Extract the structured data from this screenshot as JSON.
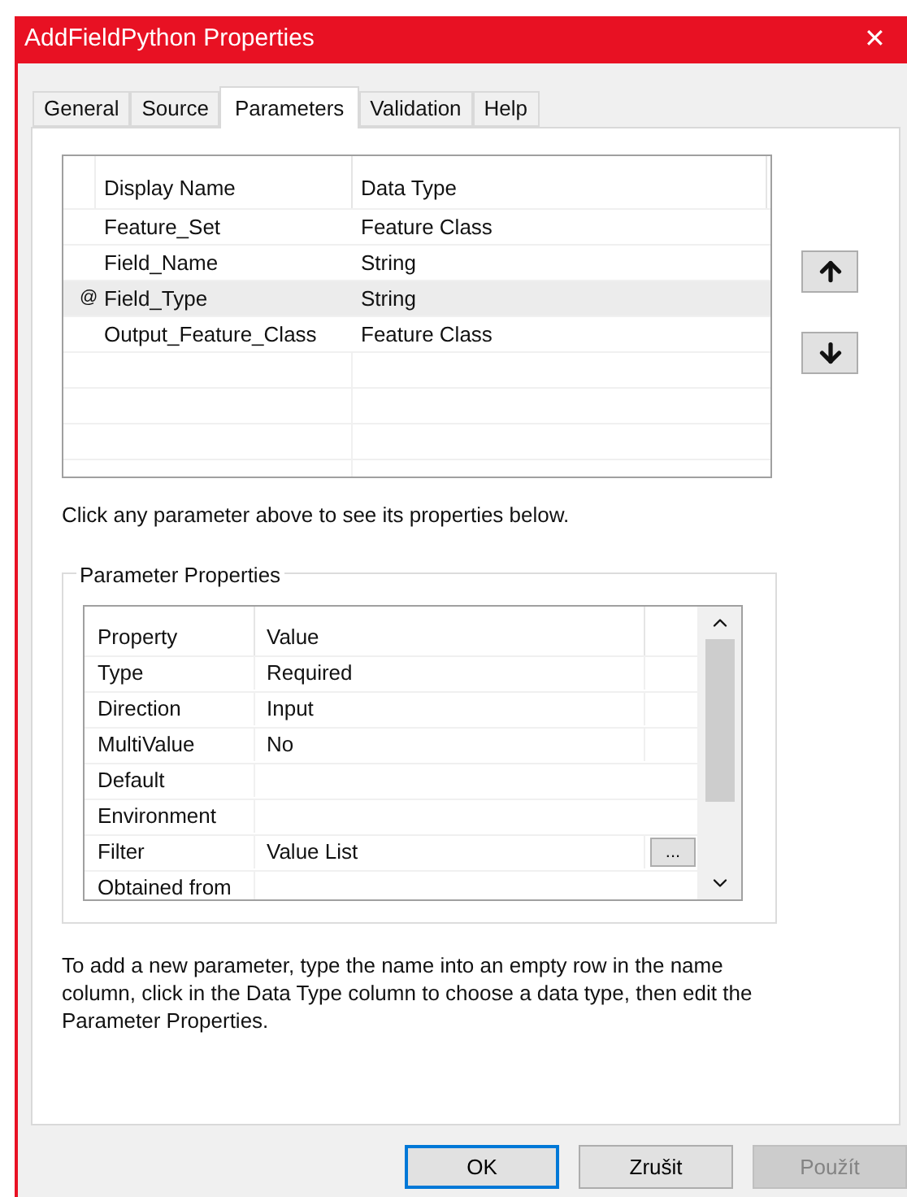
{
  "window": {
    "title": "AddFieldPython Properties",
    "close": "✕"
  },
  "tabs": [
    {
      "label": "General",
      "selected": false
    },
    {
      "label": "Source",
      "selected": false
    },
    {
      "label": "Parameters",
      "selected": true
    },
    {
      "label": "Validation",
      "selected": false
    },
    {
      "label": "Help",
      "selected": false
    }
  ],
  "parameters": {
    "columns": [
      "Display Name",
      "Data Type"
    ],
    "rows": [
      {
        "name": "Feature_Set",
        "type": "Feature Class",
        "selected": false
      },
      {
        "name": "Field_Name",
        "type": "String",
        "selected": false
      },
      {
        "name": "Field_Type",
        "type": "String",
        "selected": true,
        "marker": "@"
      },
      {
        "name": "Output_Feature_Class",
        "type": "Feature Class",
        "selected": false
      }
    ]
  },
  "hint": "Click any parameter above to see its properties below.",
  "properties": {
    "title": "Parameter Properties",
    "columns": [
      "Property",
      "Value"
    ],
    "rows": [
      {
        "property": "Type",
        "value": "Required"
      },
      {
        "property": "Direction",
        "value": "Input"
      },
      {
        "property": "MultiValue",
        "value": "No"
      },
      {
        "property": "Default"
      },
      {
        "property": "Environment"
      },
      {
        "property": "Filter",
        "value": "Value List",
        "button": "..."
      },
      {
        "property": "Obtained from"
      }
    ]
  },
  "instructions": "To add a new parameter, type the name into an empty row in the name column, click in the Data Type column to choose a data type, then edit the Parameter Properties.",
  "buttons": [
    {
      "label": "OK",
      "kind": "default",
      "disabled": false
    },
    {
      "label": "Zrušit",
      "kind": "normal",
      "disabled": false
    },
    {
      "label": "Použít",
      "kind": "normal",
      "disabled": true
    }
  ]
}
